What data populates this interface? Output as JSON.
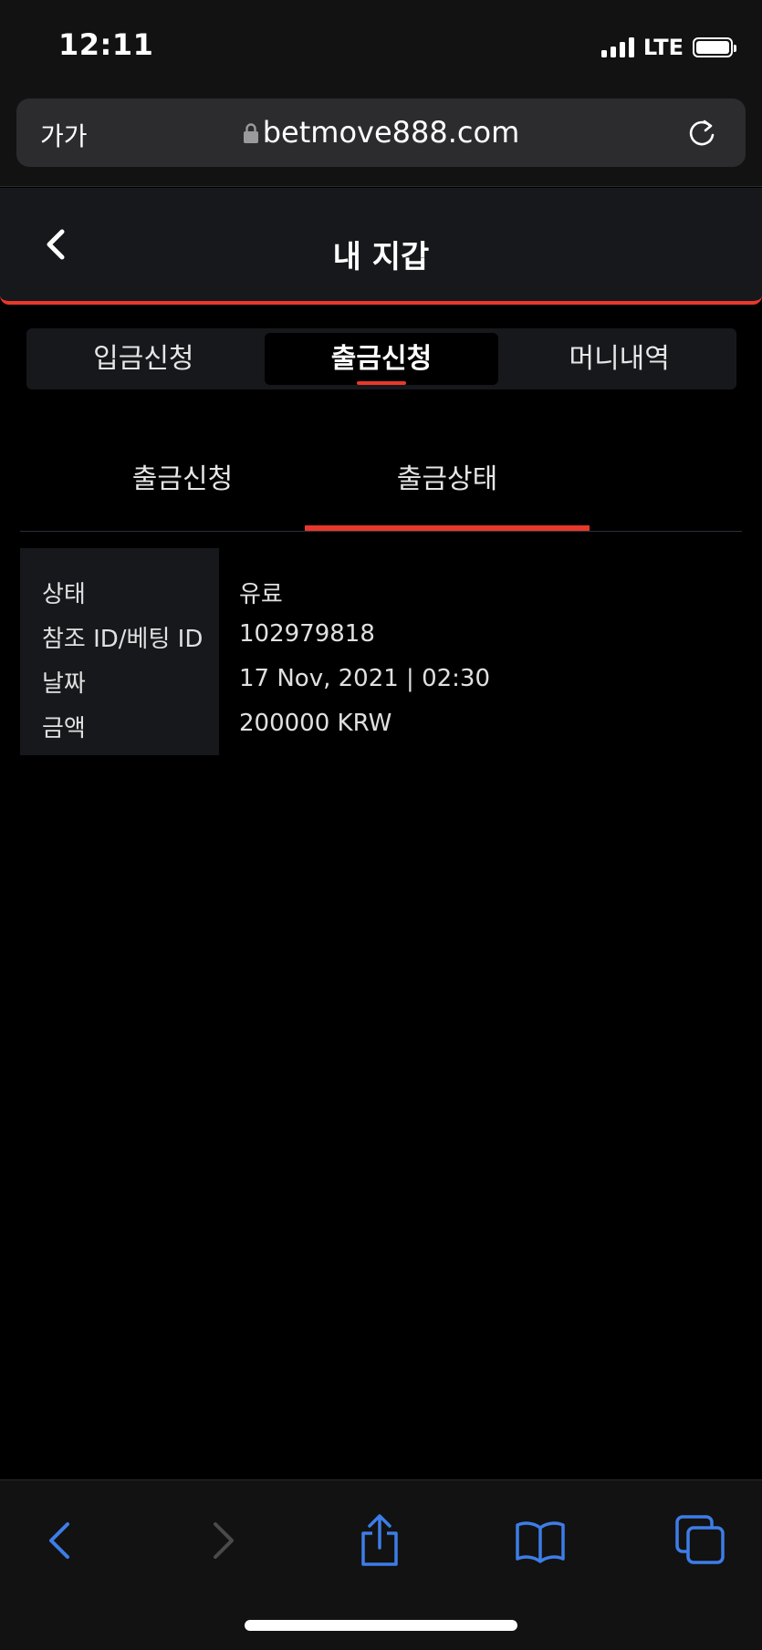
{
  "status_bar": {
    "time": "12:11",
    "network": "LTE"
  },
  "browser": {
    "text_size": "가가",
    "url": "betmove888.com"
  },
  "header": {
    "title": "내 지갑"
  },
  "main_tabs": [
    {
      "label": "입금신청",
      "active": false
    },
    {
      "label": "출금신청",
      "active": true
    },
    {
      "label": "머니내역",
      "active": false
    }
  ],
  "sub_tabs": [
    {
      "label": "출금신청",
      "active": false
    },
    {
      "label": "출금상태",
      "active": true
    }
  ],
  "details": [
    {
      "label": "상태",
      "value": "유료"
    },
    {
      "label": "참조 ID/베팅 ID",
      "value": "102979818"
    },
    {
      "label": "날짜",
      "value": "17 Nov, 2021 | 02:30"
    },
    {
      "label": "금액",
      "value": "200000 KRW"
    }
  ],
  "colors": {
    "accent": "#e8382b",
    "safari_blue": "#3d7de8",
    "panel": "#17181c"
  },
  "icons": [
    "lock-icon",
    "reload-icon",
    "back-arrow-icon",
    "browser-back-icon",
    "browser-forward-icon",
    "share-icon",
    "bookmarks-icon",
    "tabs-icon"
  ]
}
